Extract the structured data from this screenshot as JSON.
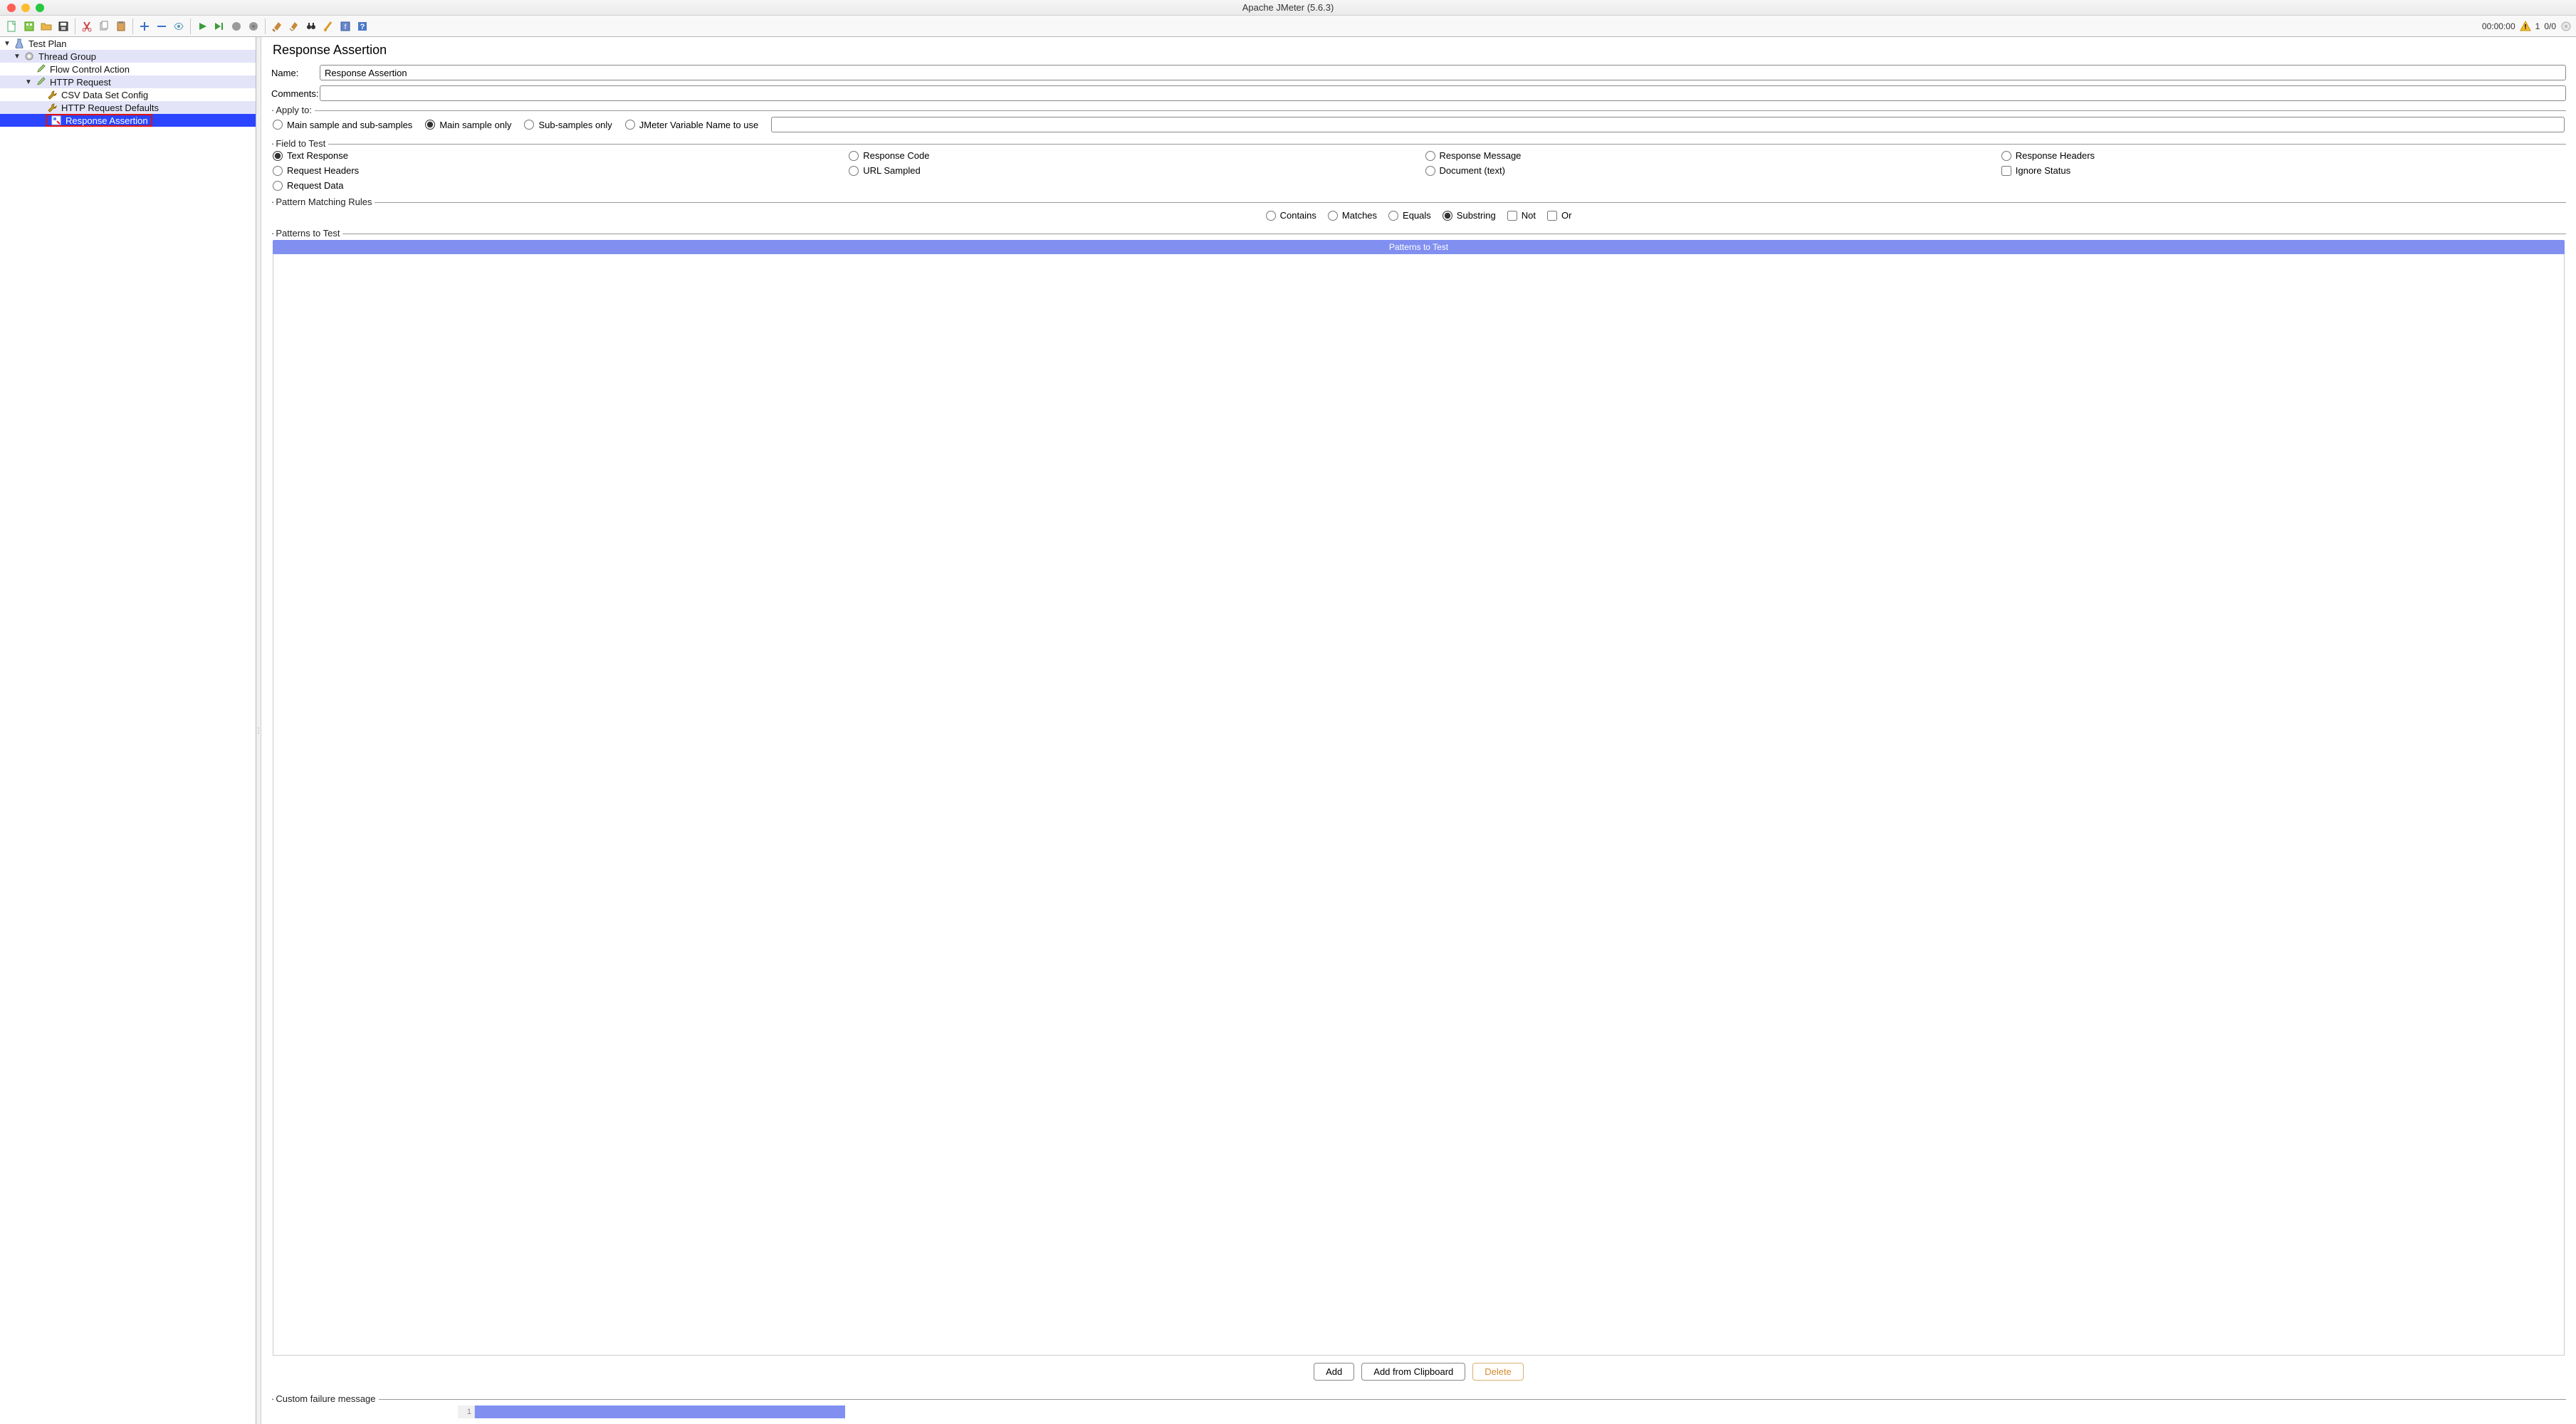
{
  "window": {
    "title": "Apache JMeter (5.6.3)"
  },
  "toolbar_right": {
    "time": "00:00:00",
    "errors": "1",
    "threads": "0/0"
  },
  "tree": {
    "root": "Test Plan",
    "thread_group": "Thread Group",
    "flow_control": "Flow Control Action",
    "http_request": "HTTP Request",
    "csv": "CSV Data Set Config",
    "defaults": "HTTP Request Defaults",
    "assertion": "Response Assertion"
  },
  "content": {
    "title": "Response Assertion",
    "name_label": "Name:",
    "name_value": "Response Assertion",
    "comments_label": "Comments:",
    "comments_value": "",
    "apply_to": {
      "legend": "Apply to:",
      "main_and_sub": "Main sample and sub-samples",
      "main_only": "Main sample only",
      "sub_only": "Sub-samples only",
      "jmeter_var": "JMeter Variable Name to use",
      "jmeter_var_value": ""
    },
    "field_to_test": {
      "legend": "Field to Test",
      "text_response": "Text Response",
      "response_code": "Response Code",
      "response_message": "Response Message",
      "response_headers": "Response Headers",
      "request_headers": "Request Headers",
      "url_sampled": "URL Sampled",
      "document_text": "Document (text)",
      "ignore_status": "Ignore Status",
      "request_data": "Request Data"
    },
    "pmr": {
      "legend": "Pattern Matching Rules",
      "contains": "Contains",
      "matches": "Matches",
      "equals": "Equals",
      "substring": "Substring",
      "not": "Not",
      "or": "Or"
    },
    "ptt": {
      "legend": "Patterns to Test",
      "header": "Patterns to Test",
      "add": "Add",
      "add_clipboard": "Add from Clipboard",
      "delete": "Delete"
    },
    "cfm": {
      "legend": "Custom failure message",
      "line_no": "1"
    }
  }
}
